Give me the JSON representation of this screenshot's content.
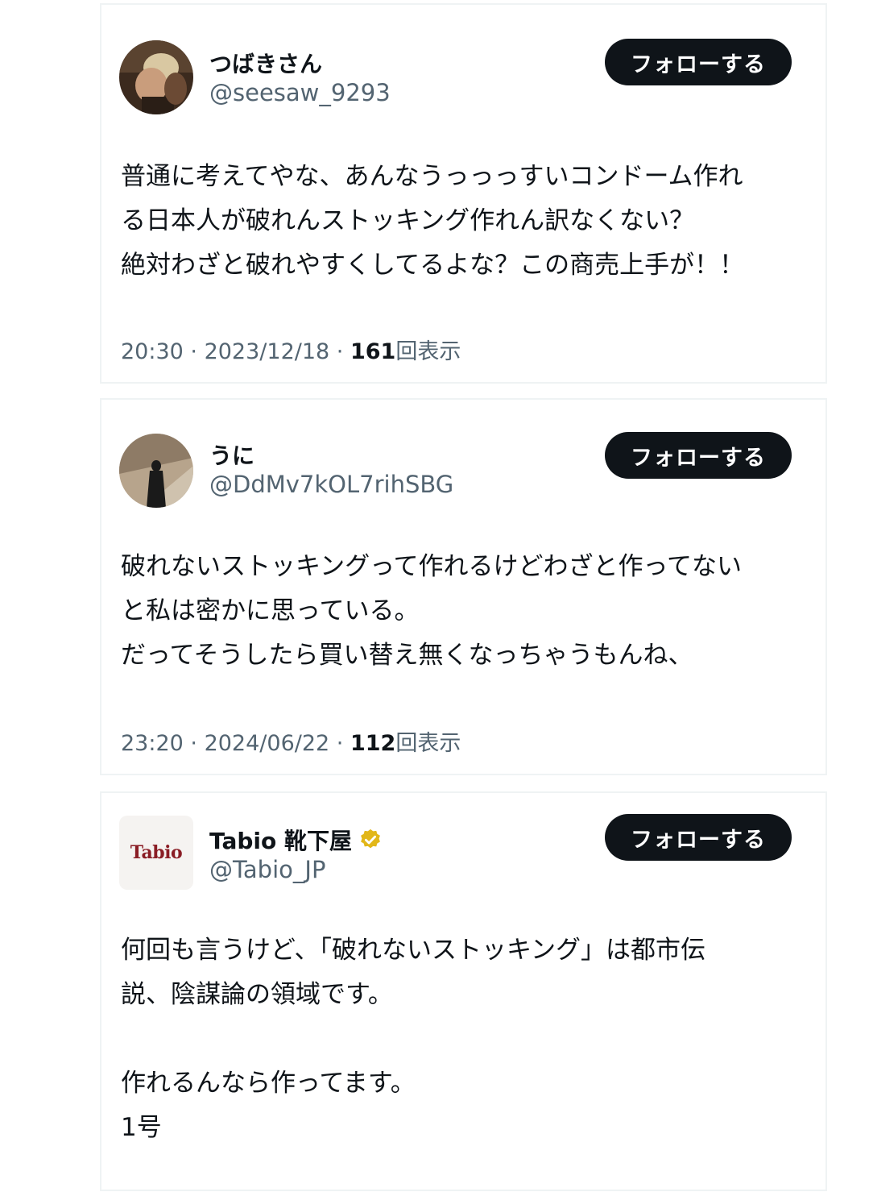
{
  "tweets": [
    {
      "display_name": "つばきさん",
      "handle": "@seesaw_9293",
      "follow_label": "フォローする",
      "lines": [
        "普通に考えてやな、あんなうっっっすいコンドーム作れ",
        "る日本人が破れんストッキング作れん訳なくない？",
        "絶対わざと破れやすくしてるよな？この商売上手が！！"
      ],
      "time": "20:30",
      "date": "2023/12/18",
      "views": "161",
      "views_label": "回表示"
    },
    {
      "display_name": "うに",
      "handle": "@DdMv7kOL7rihSBG",
      "follow_label": "フォローする",
      "lines": [
        "破れないストッキングって作れるけどわざと作ってない",
        "と私は密かに思っている。",
        "だってそうしたら買い替え無くなっちゃうもんね、"
      ],
      "time": "23:20",
      "date": "2024/06/22",
      "views": "112",
      "views_label": "回表示"
    },
    {
      "display_name": "Tabio 靴下屋",
      "handle": "@Tabio_JP",
      "follow_label": "フォローする",
      "logo_text": "Tabio",
      "verified": true,
      "lines": [
        "何回も言うけど、「破れないストッキング」は都市伝",
        "説、陰謀論の領域です。",
        "",
        "作れるんなら作ってます。",
        "1号"
      ]
    }
  ],
  "separator": "·",
  "colors": {
    "text_primary": "#0f1419",
    "text_secondary": "#536471",
    "follow_button_bg": "#0f1419",
    "verified_gold": "#e2b719",
    "logo_red": "#8a1d25",
    "card_border": "#eff3f4"
  },
  "icons": {
    "verified": "verified-gold-badge-icon"
  }
}
